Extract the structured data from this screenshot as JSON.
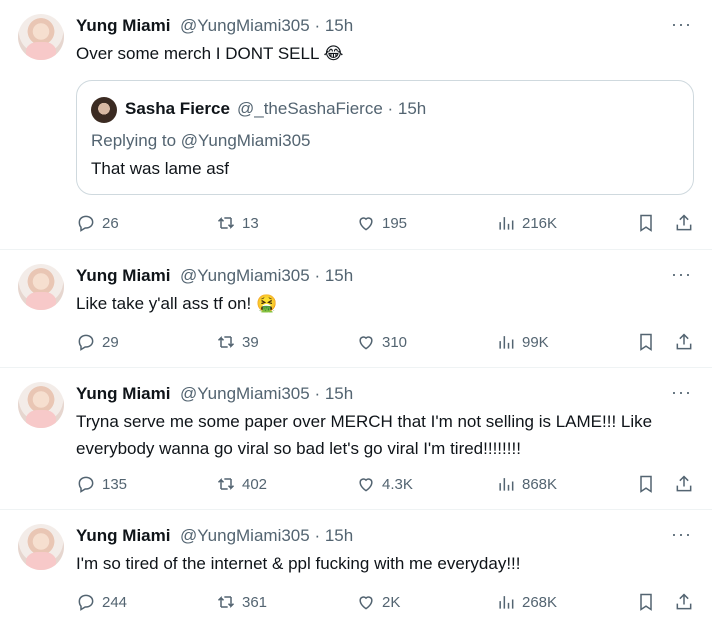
{
  "tweets": [
    {
      "name": "Yung Miami",
      "handle": "@YungMiami305 · 15h",
      "text": "Over some merch I DONT SELL 😂",
      "quote": {
        "name": "Sasha Fierce",
        "handle": "@_theSashaFierce · 15h",
        "replying": "Replying to @YungMiami305",
        "text": "That was lame asf"
      },
      "replies": "26",
      "retweets": "13",
      "likes": "195",
      "views": "216K"
    },
    {
      "name": "Yung Miami",
      "handle": "@YungMiami305 · 15h",
      "text": "Like take y'all ass tf on! 🤮",
      "replies": "29",
      "retweets": "39",
      "likes": "310",
      "views": "99K"
    },
    {
      "name": "Yung Miami",
      "handle": "@YungMiami305 · 15h",
      "text": "Tryna serve me some paper over MERCH that I'm not selling is LAME!!! Like everybody wanna go viral so bad let's go viral I'm tired!!!!!!!!",
      "replies": "135",
      "retweets": "402",
      "likes": "4.3K",
      "views": "868K"
    },
    {
      "name": "Yung Miami",
      "handle": "@YungMiami305 · 15h",
      "text": "I'm so tired of the internet & ppl fucking with me everyday!!!",
      "replies": "244",
      "retweets": "361",
      "likes": "2K",
      "views": "268K"
    }
  ],
  "more_label": "···",
  "icons": [
    "reply-icon",
    "retweet-icon",
    "like-icon",
    "views-icon",
    "bookmark-icon",
    "share-icon",
    "more-icon"
  ],
  "colors": {
    "text": "#0f1419",
    "muted": "#536471",
    "border": "#cfd9de"
  }
}
